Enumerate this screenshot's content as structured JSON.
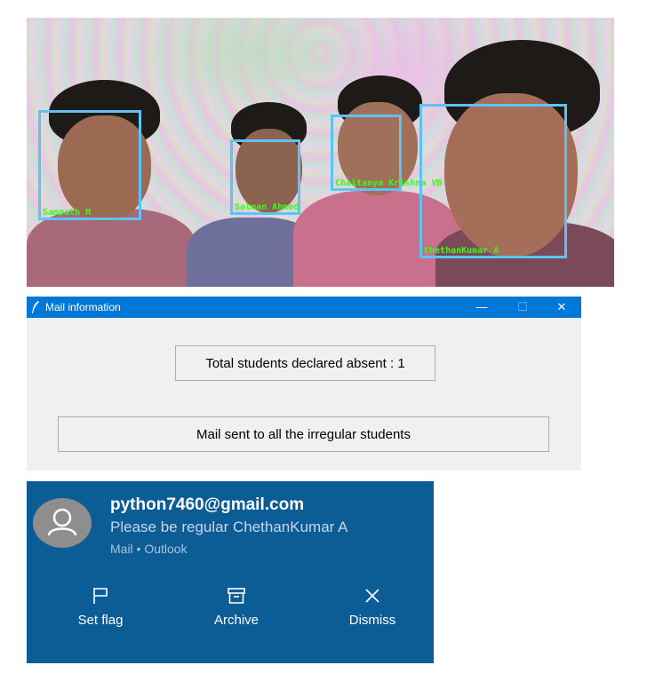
{
  "photo": {
    "faces": [
      {
        "name": "Sampath M"
      },
      {
        "name": "Salman Ahmed"
      },
      {
        "name": "Chaitanya Krishna VB"
      },
      {
        "name": "ChethanKumar A"
      }
    ]
  },
  "tk_window": {
    "title": "Mail information",
    "controls": {
      "minimize": "—",
      "maximize": "☐",
      "close": "✕"
    },
    "absent_button": "Total students declared absent : 1",
    "mail_button": "Mail sent to all the irregular students"
  },
  "notification": {
    "sender": "python7460@gmail.com",
    "message": "Please be regular ChethanKumar A",
    "app": "Mail • Outlook",
    "actions": {
      "flag": "Set flag",
      "archive": "Archive",
      "dismiss": "Dismiss"
    }
  },
  "colors": {
    "face_box": "#5ec3f4",
    "face_label": "#39ff14",
    "titlebar": "#0078d7",
    "toast_bg": "#0c5c96"
  },
  "icons": [
    "feather-icon",
    "user-avatar-icon",
    "flag-icon",
    "archive-icon",
    "close-icon"
  ]
}
